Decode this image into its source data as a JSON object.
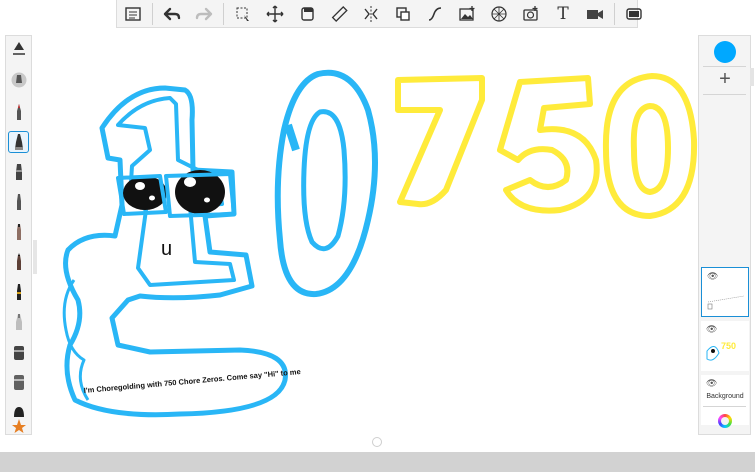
{
  "toolbar": {
    "buttons": [
      {
        "name": "gallery-icon",
        "glyph": "gallery"
      },
      {
        "name": "undo-icon",
        "glyph": "undo"
      },
      {
        "name": "redo-icon",
        "glyph": "redo"
      },
      {
        "name": "selection-icon",
        "glyph": "select"
      },
      {
        "name": "transform-icon",
        "glyph": "move"
      },
      {
        "name": "crop-icon",
        "glyph": "crop"
      },
      {
        "name": "ruler-icon",
        "glyph": "ruler"
      },
      {
        "name": "symmetry-icon",
        "glyph": "symmetry"
      },
      {
        "name": "fill-icon",
        "glyph": "fill"
      },
      {
        "name": "curve-icon",
        "glyph": "curve"
      },
      {
        "name": "image-import-icon",
        "glyph": "image"
      },
      {
        "name": "perspective-grid-icon",
        "glyph": "grid"
      },
      {
        "name": "stamp-icon",
        "glyph": "stamp"
      },
      {
        "name": "text-icon",
        "glyph": "T"
      },
      {
        "name": "time-lapse-icon",
        "glyph": "video"
      },
      {
        "name": "fullscreen-icon",
        "glyph": "fullscreen"
      }
    ]
  },
  "brushes": [
    {
      "name": "brush-settings-icon",
      "selected": false
    },
    {
      "name": "brush-pencil-icon",
      "selected": false
    },
    {
      "name": "brush-pen-icon",
      "selected": false
    },
    {
      "name": "brush-marker-icon",
      "selected": true
    },
    {
      "name": "brush-airbrush-icon",
      "selected": false
    },
    {
      "name": "brush-chisel-icon",
      "selected": false
    },
    {
      "name": "brush-paint-icon",
      "selected": false
    },
    {
      "name": "brush-ink-icon",
      "selected": false
    },
    {
      "name": "brush-calligraphy-icon",
      "selected": false
    },
    {
      "name": "brush-smudge-icon",
      "selected": false
    },
    {
      "name": "brush-blender-icon",
      "selected": false
    },
    {
      "name": "brush-eraser-icon",
      "selected": false
    },
    {
      "name": "brush-texture-icon",
      "selected": false
    },
    {
      "name": "brush-custom-icon",
      "selected": false
    }
  ],
  "colors": {
    "current_color": "#00a8ff",
    "blue_stroke": "#29b6f6",
    "yellow_stroke": "#ffeb3b",
    "accent": "#1a8fd6"
  },
  "right_panel": {
    "add_layer_label": "+",
    "eye_glyph": "👁",
    "background_label": "Background"
  },
  "drawing": {
    "speech_bubble_text": "I'm Choregolding with 750 Chore Zeros. Come say \"Hi\" to me",
    "big_digits": [
      "1",
      "0",
      "7",
      "5",
      "0"
    ],
    "mouth_glyph": "u"
  }
}
